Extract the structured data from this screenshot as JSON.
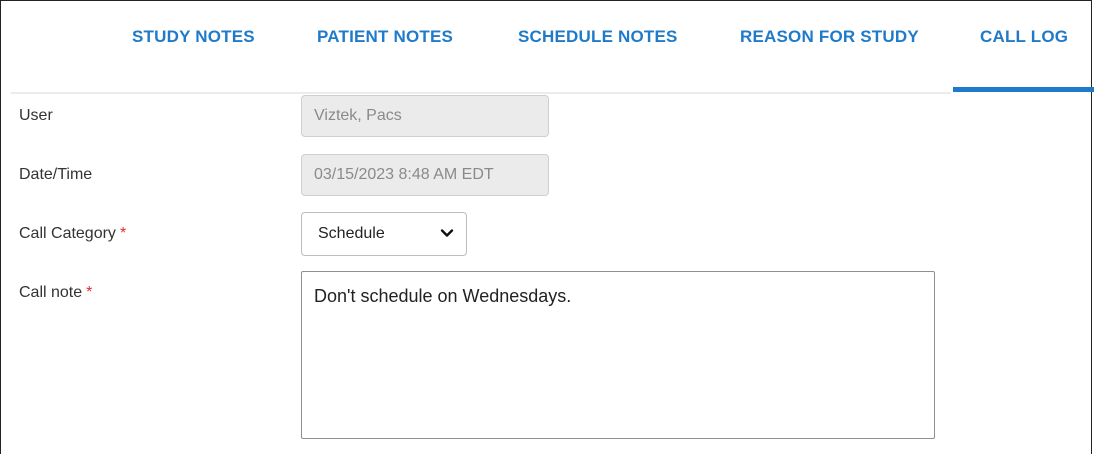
{
  "tabs": [
    {
      "label": "STUDY NOTES"
    },
    {
      "label": "PATIENT NOTES"
    },
    {
      "label": "SCHEDULE NOTES"
    },
    {
      "label": "REASON FOR STUDY"
    },
    {
      "label": "CALL LOG",
      "active": true
    }
  ],
  "form": {
    "user_label": "User",
    "user_value": "Viztek, Pacs",
    "datetime_label": "Date/Time",
    "datetime_value": "03/15/2023 8:48 AM EDT",
    "category_label": "Call Category",
    "category_value": "Schedule",
    "note_label": "Call note",
    "note_value": "Don't schedule on Wednesdays.",
    "required_marker": "*"
  },
  "colors": {
    "accent": "#1f7bc9",
    "required": "#e02b2b",
    "readonly_bg": "#ebebeb"
  },
  "icons": {
    "dropdown": "chevron-down-icon"
  }
}
